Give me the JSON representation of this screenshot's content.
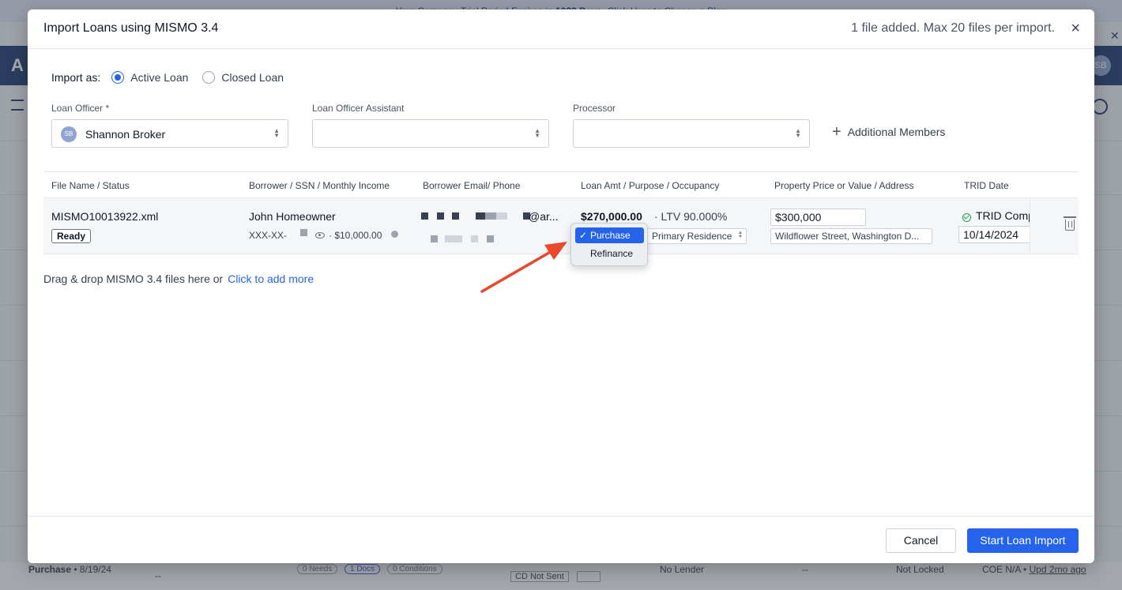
{
  "background": {
    "banner_pre": "Your Company Trial Period Expires in ",
    "banner_days": "1022 Days",
    "banner_post": ". Click Here to Choose a Plan",
    "logo": "A",
    "avatar": "SB",
    "row": {
      "purpose": "Purchase",
      "date": "• 8/19/24",
      "dash1": "--",
      "needs": "0 Needs",
      "docs": "1 Docs",
      "conditions": "0 Conditions",
      "cd_status": "CD Not Sent",
      "lender": "No Lender",
      "dash2": "--",
      "lock": "Not Locked",
      "coe": "COE N/A •",
      "updated": "Upd 2mo ago"
    }
  },
  "modal": {
    "title": "Import Loans using MISMO 3.4",
    "file_count": "1 file added. Max 20 files per import.",
    "close": "×",
    "import_as_label": "Import as:",
    "import_options": [
      {
        "label": "Active Loan",
        "selected": true
      },
      {
        "label": "Closed Loan",
        "selected": false
      }
    ],
    "fields": {
      "loan_officer": {
        "label": "Loan Officer *",
        "value": "Shannon Broker",
        "badge": "SB"
      },
      "assistant": {
        "label": "Loan Officer Assistant",
        "value": ""
      },
      "processor": {
        "label": "Processor",
        "value": ""
      }
    },
    "additional_members": "Additional Members",
    "columns": [
      "File Name / Status",
      "Borrower / SSN / Monthly Income",
      "Borrower Email/ Phone",
      "Loan Amt / Purpose / Occupancy",
      "Property Price or Value / Address",
      "TRID Date"
    ],
    "row": {
      "file_name": "MISMO10013922.xml",
      "status": "Ready",
      "borrower": "John Homeowner",
      "ssn": "XXX-XX-",
      "income": "· $10,000.00",
      "email_suffix": "@ar...",
      "loan_amount": "$270,000.00",
      "ltv": "· LTV 90.000%",
      "occupancy": "Primary Residence",
      "property_price": "$300,000",
      "address": "Wildflower Street, Washington D...",
      "trid_status": "TRID Comp",
      "trid_date": "10/14/2024"
    },
    "purpose_menu": {
      "options": [
        "Purchase",
        "Refinance"
      ],
      "selected": "Purchase",
      "tick": "✓"
    },
    "drop_text": "Drag & drop MISMO 3.4 files here or",
    "drop_link": "Click to add more",
    "cancel": "Cancel",
    "start": "Start Loan Import"
  },
  "colors": {
    "accent": "#2563eb",
    "annotation_arrow": "#e8482b",
    "success": "#16a34a"
  }
}
